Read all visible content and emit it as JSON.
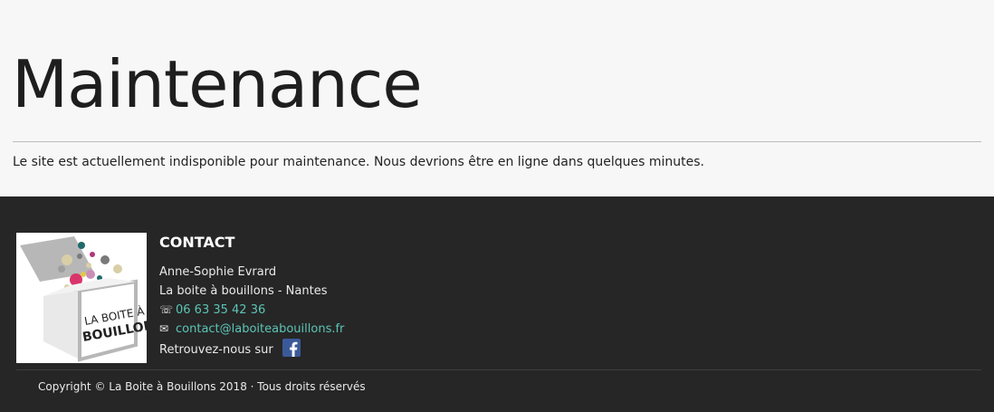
{
  "main": {
    "title": "Maintenance",
    "message": "Le site est actuellement indisponible pour maintenance. Nous devrions être en ligne dans quelques minutes."
  },
  "footer": {
    "logo_text_line1": "LA BOITE À",
    "logo_text_line2": "BOUILLONS",
    "contact_heading": "CONTACT",
    "name": "Anne-Sophie Evrard",
    "company": "La boite à bouillons - Nantes",
    "phone_icon": "phone-icon",
    "phone": "06 63 35 42 36",
    "email_icon": "envelope-icon",
    "email": "contact@laboiteabouillons.fr",
    "social_label": "Retrouvez-nous sur",
    "social_icon": "facebook-icon",
    "copyright": "Copyright © La Boite à Bouillons 2018 · Tous droits réservés"
  },
  "colors": {
    "background": "#f7f7f7",
    "footer_background": "#262626",
    "link": "#5cc5b6",
    "facebook": "#3b5998"
  }
}
